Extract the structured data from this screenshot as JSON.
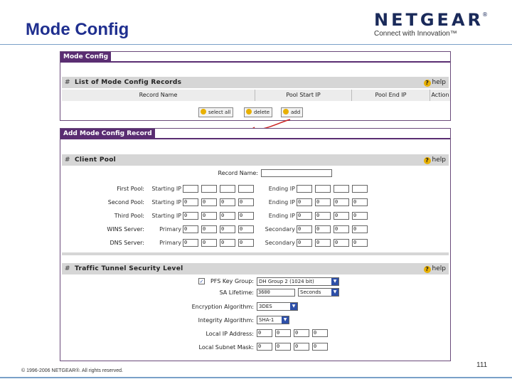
{
  "slide": {
    "title": "Mode Config",
    "logo_word": "NETGEAR",
    "logo_reg": "®",
    "logo_tagline": "Connect with Innovation™",
    "copyright": "© 1996-2006 NETGEAR®. All rights reserved.",
    "page_number": "111"
  },
  "list_panel": {
    "tab_label": "Mode Config",
    "section_title": "List of Mode Config Records",
    "help_label": "help",
    "columns": [
      "Record Name",
      "Pool Start IP",
      "Pool End IP",
      "Action"
    ],
    "buttons": {
      "select_all": "select all",
      "delete": "delete",
      "add": "add"
    }
  },
  "add_panel": {
    "tab_label": "Add Mode Config Record",
    "client_pool": {
      "section_title": "Client Pool",
      "help_label": "help",
      "record_name_label": "Record Name:",
      "record_name_value": "",
      "rows": [
        {
          "label": "First Pool:",
          "left_sub": "Starting IP",
          "right_sub": "Ending IP",
          "left": [
            "",
            "",
            "",
            ""
          ],
          "right": [
            "",
            "",
            "",
            ""
          ]
        },
        {
          "label": "Second Pool:",
          "left_sub": "Starting IP",
          "right_sub": "Ending IP",
          "left": [
            "0",
            "0",
            "0",
            "0"
          ],
          "right": [
            "0",
            "0",
            "0",
            "0"
          ]
        },
        {
          "label": "Third Pool:",
          "left_sub": "Starting IP",
          "right_sub": "Ending IP",
          "left": [
            "0",
            "0",
            "0",
            "0"
          ],
          "right": [
            "0",
            "0",
            "0",
            "0"
          ]
        },
        {
          "label": "WINS Server:",
          "left_sub": "Primary",
          "right_sub": "Secondary",
          "left": [
            "0",
            "0",
            "0",
            "0"
          ],
          "right": [
            "0",
            "0",
            "0",
            "0"
          ]
        },
        {
          "label": "DNS Server:",
          "left_sub": "Primary",
          "right_sub": "Secondary",
          "left": [
            "0",
            "0",
            "0",
            "0"
          ],
          "right": [
            "0",
            "0",
            "0",
            "0"
          ]
        }
      ]
    },
    "traffic": {
      "section_title": "Traffic Tunnel Security Level",
      "help_label": "help",
      "pfs_label": "PFS Key Group:",
      "pfs_checked": true,
      "pfs_value": "DH Group 2 (1024 bit)",
      "sa_lifetime_label": "SA Lifetime:",
      "sa_lifetime_value": "3600",
      "sa_lifetime_unit": "Seconds",
      "encryption_label": "Encryption Algorithm:",
      "encryption_value": "3DES",
      "integrity_label": "Integrity Algorithm:",
      "integrity_value": "SHA-1",
      "local_ip_label": "Local IP Address:",
      "local_ip": [
        "0",
        "0",
        "0",
        "0"
      ],
      "local_mask_label": "Local Subnet Mask:",
      "local_mask": [
        "0",
        "0",
        "0",
        "0"
      ]
    }
  },
  "colors": {
    "title_blue": "#1f2f8f",
    "tab_purple": "#5a2d72",
    "section_gray": "#d6d6d6",
    "arrow_red": "#cc2222"
  }
}
